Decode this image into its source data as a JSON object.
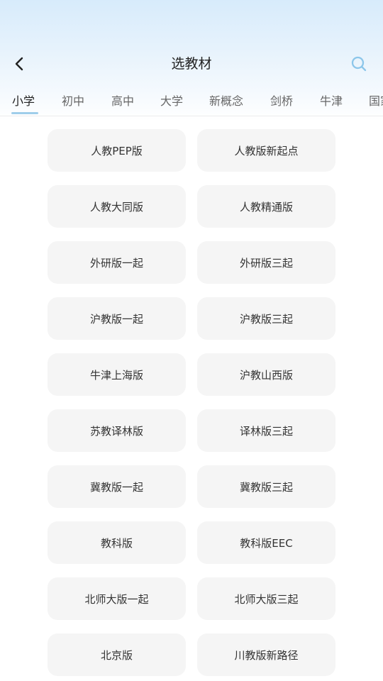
{
  "header": {
    "title": "选教材",
    "back_icon": "chevron-left-icon",
    "search_icon": "search-icon",
    "accent_color": "#9fcdea"
  },
  "tabs": [
    {
      "label": "小学",
      "active": true
    },
    {
      "label": "初中",
      "active": false
    },
    {
      "label": "高中",
      "active": false
    },
    {
      "label": "大学",
      "active": false
    },
    {
      "label": "新概念",
      "active": false
    },
    {
      "label": "剑桥",
      "active": false
    },
    {
      "label": "牛津",
      "active": false
    },
    {
      "label": "国家",
      "active": false
    }
  ],
  "textbooks": [
    "人教PEP版",
    "人教版新起点",
    "人教大同版",
    "人教精通版",
    "外研版一起",
    "外研版三起",
    "沪教版一起",
    "沪教版三起",
    "牛津上海版",
    "沪教山西版",
    "苏教译林版",
    "译林版三起",
    "冀教版一起",
    "冀教版三起",
    "教科版",
    "教科版EEC",
    "北师大版一起",
    "北师大版三起",
    "北京版",
    "川教版新路径"
  ]
}
